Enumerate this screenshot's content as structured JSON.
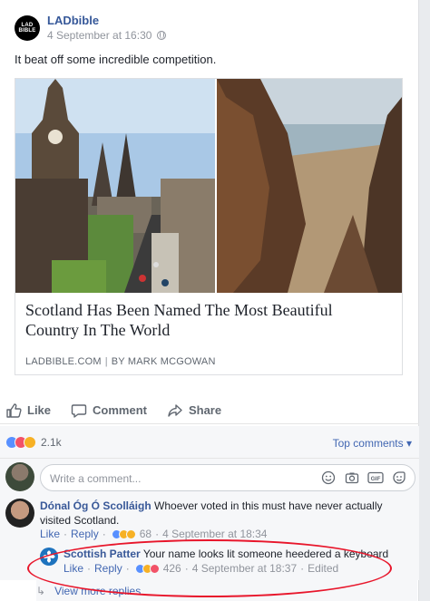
{
  "post": {
    "page_name": "LADbible",
    "logo_text_top": "LAD",
    "logo_text_bottom": "BIBLE",
    "timestamp": "4 September at 16:30",
    "text": "It beat off some incredible competition."
  },
  "link_preview": {
    "title": "Scotland Has Been Named The Most Beautiful Country In The World",
    "domain": "LADBIBLE.COM",
    "separator": "|",
    "author": "BY MARK MCGOWAN"
  },
  "actions": {
    "like": "Like",
    "comment": "Comment",
    "share": "Share"
  },
  "reactions": {
    "count": "2.1k",
    "types": [
      "like",
      "love",
      "haha"
    ],
    "top_comments_label": "Top comments",
    "colors": {
      "like": "#5890ff",
      "love": "#f25268",
      "haha": "#f7b125"
    }
  },
  "composer": {
    "placeholder": "Write a comment..."
  },
  "comments": [
    {
      "author": "Dónal Óg Ó Scolláigh",
      "text": "Whoever voted in this must have never actually visited Scotland.",
      "like_label": "Like",
      "reply_label": "Reply",
      "reaction_count": "68",
      "timestamp": "4 September at 18:34",
      "separator": "·"
    }
  ],
  "reply": {
    "author": "Scottish Patter",
    "text": "Your name looks lit someone heedered a keyboard",
    "like_label": "Like",
    "reply_label": "Reply",
    "reaction_count": "426",
    "timestamp": "4 September at 18:37",
    "edited": "Edited",
    "separator": "·"
  },
  "view_more": {
    "arrow": "↳",
    "label": "View more replies"
  }
}
